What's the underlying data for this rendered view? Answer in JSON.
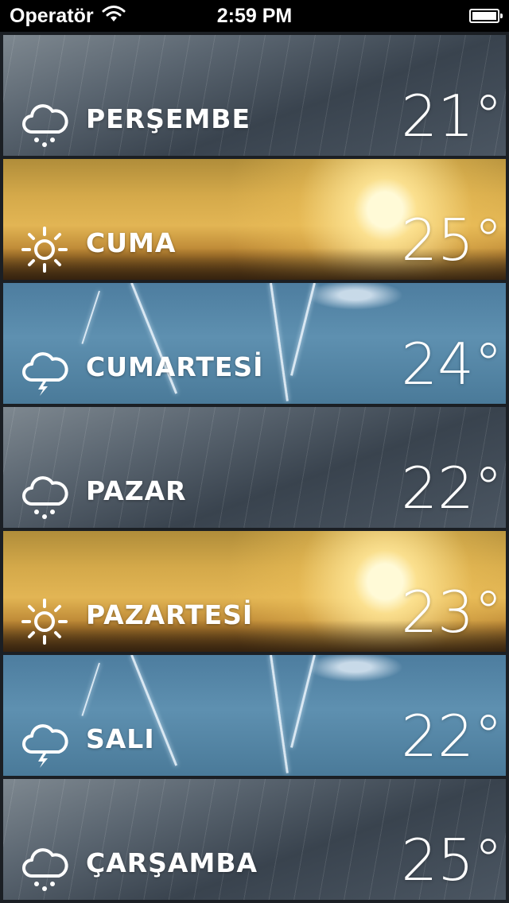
{
  "status_bar": {
    "carrier": "Operatör",
    "time": "2:59 PM",
    "battery_level": 1.0
  },
  "forecast": [
    {
      "day": "PERŞEMBE",
      "temperature": "21°",
      "condition_icon": "rain-cloud-icon",
      "background": "rain"
    },
    {
      "day": "CUMA",
      "temperature": "25°",
      "condition_icon": "sun-icon",
      "background": "sun"
    },
    {
      "day": "CUMARTESİ",
      "temperature": "24°",
      "condition_icon": "thunder-cloud-icon",
      "background": "storm"
    },
    {
      "day": "PAZAR",
      "temperature": "22°",
      "condition_icon": "rain-cloud-icon",
      "background": "rain"
    },
    {
      "day": "PAZARTESİ",
      "temperature": "23°",
      "condition_icon": "sun-icon",
      "background": "sun"
    },
    {
      "day": "SALI",
      "temperature": "22°",
      "condition_icon": "thunder-cloud-icon",
      "background": "storm"
    },
    {
      "day": "ÇARŞAMBA",
      "temperature": "25°",
      "condition_icon": "rain-cloud-icon",
      "background": "rain"
    }
  ],
  "colors": {
    "text": "#ffffff",
    "status_bar_bg": "#000000"
  }
}
